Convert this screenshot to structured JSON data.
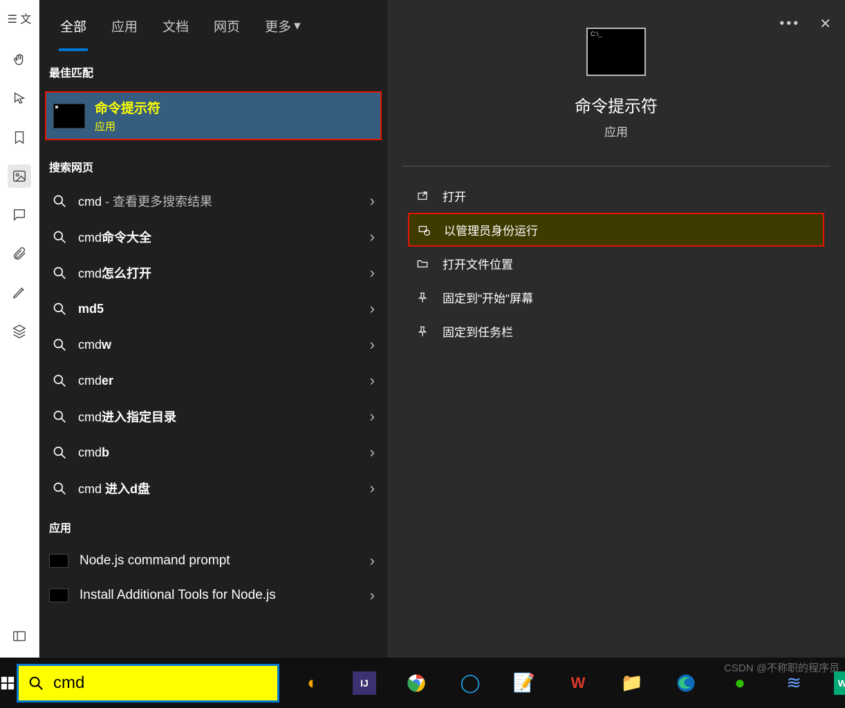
{
  "left_strip": {
    "top_label": "☰ 文",
    "icons": [
      "hand",
      "cursor",
      "bookmark",
      "image",
      "chat",
      "paperclip",
      "pen",
      "layers",
      "sidebar"
    ]
  },
  "tabs": {
    "items": [
      "全部",
      "应用",
      "文档",
      "网页",
      "更多"
    ],
    "active_index": 0
  },
  "sections": {
    "best_match": "最佳匹配",
    "search_web": "搜索网页",
    "apps": "应用"
  },
  "best_match_item": {
    "title": "命令提示符",
    "subtitle": "应用"
  },
  "web_results": [
    {
      "pre": "cmd",
      "bold": "",
      "suffix": " - 查看更多搜索结果"
    },
    {
      "pre": "cmd",
      "bold": "命令大全",
      "suffix": ""
    },
    {
      "pre": "cmd",
      "bold": "怎么打开",
      "suffix": ""
    },
    {
      "pre": "",
      "bold": "md5",
      "suffix": ""
    },
    {
      "pre": "cmd",
      "bold": "w",
      "suffix": ""
    },
    {
      "pre": "cmd",
      "bold": "er",
      "suffix": ""
    },
    {
      "pre": "cmd",
      "bold": "进入指定目录",
      "suffix": ""
    },
    {
      "pre": "cmd",
      "bold": "b",
      "suffix": ""
    },
    {
      "pre": "cmd ",
      "bold": "进入d盘",
      "suffix": ""
    }
  ],
  "app_results": [
    {
      "label": "Node.js command prompt"
    },
    {
      "label": "Install Additional Tools for Node.js"
    }
  ],
  "preview": {
    "title": "命令提示符",
    "subtitle": "应用",
    "actions": [
      {
        "icon": "open",
        "label": "打开",
        "highlight": false
      },
      {
        "icon": "admin",
        "label": "以管理员身份运行",
        "highlight": true
      },
      {
        "icon": "folder",
        "label": "打开文件位置",
        "highlight": false
      },
      {
        "icon": "pin-start",
        "label": "固定到\"开始\"屏幕",
        "highlight": false
      },
      {
        "icon": "pin-taskbar",
        "label": "固定到任务栏",
        "highlight": false
      }
    ]
  },
  "search_box": {
    "value": "cmd"
  },
  "taskbar_icons": [
    "safe",
    "ij",
    "chrome",
    "edge-circle",
    "notepad",
    "wps",
    "files",
    "edge",
    "wechat",
    "wifi",
    "ws"
  ],
  "watermark": "CSDN @不称职的程序员"
}
